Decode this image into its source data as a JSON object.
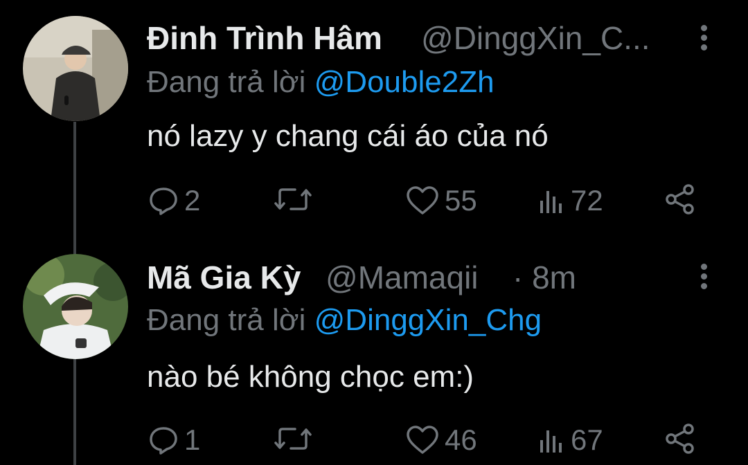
{
  "tweets": [
    {
      "display_name": "Đinh Trình Hâm",
      "handle": "@DinggXin_C...",
      "time": "",
      "replying_prefix": "Đang trả lời ",
      "replying_to": "@Double2Zh",
      "text": "nó lazy y chang cái áo của nó",
      "stats": {
        "replies": "2",
        "retweets": "",
        "likes": "55",
        "views": "72"
      }
    },
    {
      "display_name": "Mã Gia Kỳ",
      "handle": "@Mamaqii",
      "time": "· 8m",
      "replying_prefix": "Đang trả lời ",
      "replying_to": "@DinggXin_Chg",
      "text": "nào bé không chọc em:)",
      "stats": {
        "replies": "1",
        "retweets": "",
        "likes": "46",
        "views": "67"
      }
    }
  ],
  "icons": [
    "reply-icon",
    "retweet-icon",
    "like-icon",
    "views-icon",
    "share-icon",
    "more-options-icon"
  ],
  "colors": {
    "background": "#000000",
    "text": "#e7e9ea",
    "muted": "#71767b",
    "mention": "#1d9bf0",
    "thread_line": "#3e4144"
  }
}
